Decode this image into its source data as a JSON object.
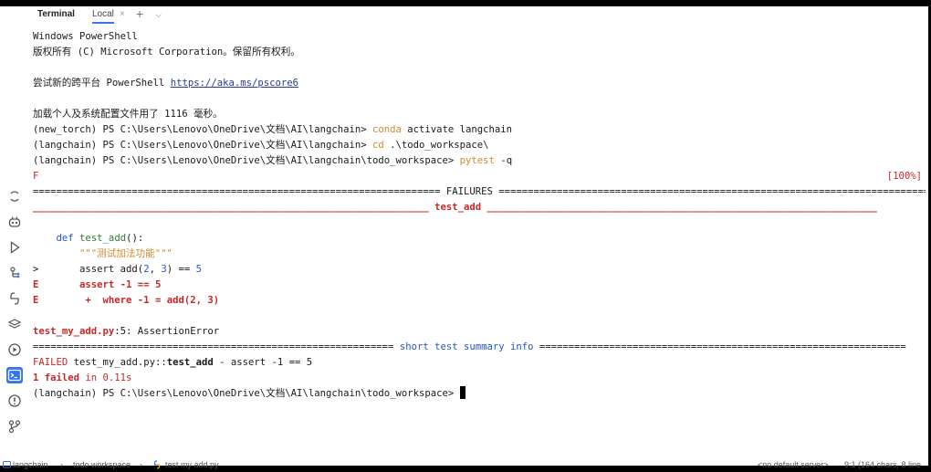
{
  "tabs": {
    "terminal": "Terminal",
    "local": "Local",
    "close": "×",
    "add": "+",
    "more": "⌵"
  },
  "terminal": {
    "l1": "Windows PowerShell",
    "l2": "版权所有 (C) Microsoft Corporation。保留所有权利。",
    "l4a": "尝试新的跨平台 PowerShell ",
    "l4link": "https://aka.ms/pscore6",
    "l6": "加载个人及系统配置文件用了 1116 毫秒。",
    "l7a": "(new_torch) PS C:\\Users\\Lenovo\\OneDrive\\文档\\AI\\langchain> ",
    "l7kw": "conda",
    "l7b": " activate langchain",
    "l8a": "(langchain) PS C:\\Users\\Lenovo\\OneDrive\\文档\\AI\\langchain> ",
    "l8kw": "cd",
    "l8b": " .\\todo_workspace\\",
    "l9a": "(langchain) PS C:\\Users\\Lenovo\\OneDrive\\文档\\AI\\langchain\\todo_workspace> ",
    "l9kw": "pytest",
    "l9b": " -q",
    "l10": "F",
    "l10pct": "[100%]",
    "l11a": "====================================================================== ",
    "l11b": "FAILURES",
    "l11c": " ==========================================================================",
    "l12a": "____________________________________________________________________ ",
    "l12b": "test_add",
    "l12c": " ___________________________________________________________________",
    "l14a": "    ",
    "l14def": "def",
    "l14sp": " ",
    "l14fn": "test_add",
    "l14b": "():",
    "l15a": "        ",
    "l15doc": "\"\"\"测试加法功能\"\"\"",
    "l16a": ">       assert add(",
    "l16n1": "2",
    "l16b": ", ",
    "l16n2": "3",
    "l16c": ") == ",
    "l16n3": "5",
    "l17a": "E       ",
    "l17b": "assert -1 == 5",
    "l18a": "E        ",
    "l18b": "+  where -1 = add(2, 3)",
    "l20a": "test_my_add.py",
    "l20b": ":5: AssertionError",
    "l21a": "============================================================== ",
    "l21b": "short test summary info",
    "l21c": " ===============================================================",
    "l22a": "FAILED",
    "l22b": " test_my_add.py::",
    "l22c": "test_add",
    "l22d": " - assert -1 == 5",
    "l23a": "1 failed",
    "l23b": " in 0.11s",
    "l24": "(langchain) PS C:\\Users\\Lenovo\\OneDrive\\文档\\AI\\langchain\\todo_workspace> "
  },
  "status": {
    "crumb1": "langchain",
    "sep": "›",
    "crumb2": "todo workspace",
    "crumb3": "test my add.py",
    "server": "<no default server>",
    "pos": "9:1 (164 chars, 8 line"
  },
  "colors": {
    "accent": "#3574f0",
    "error": "#c62828",
    "keyword": "#d08b2e"
  }
}
